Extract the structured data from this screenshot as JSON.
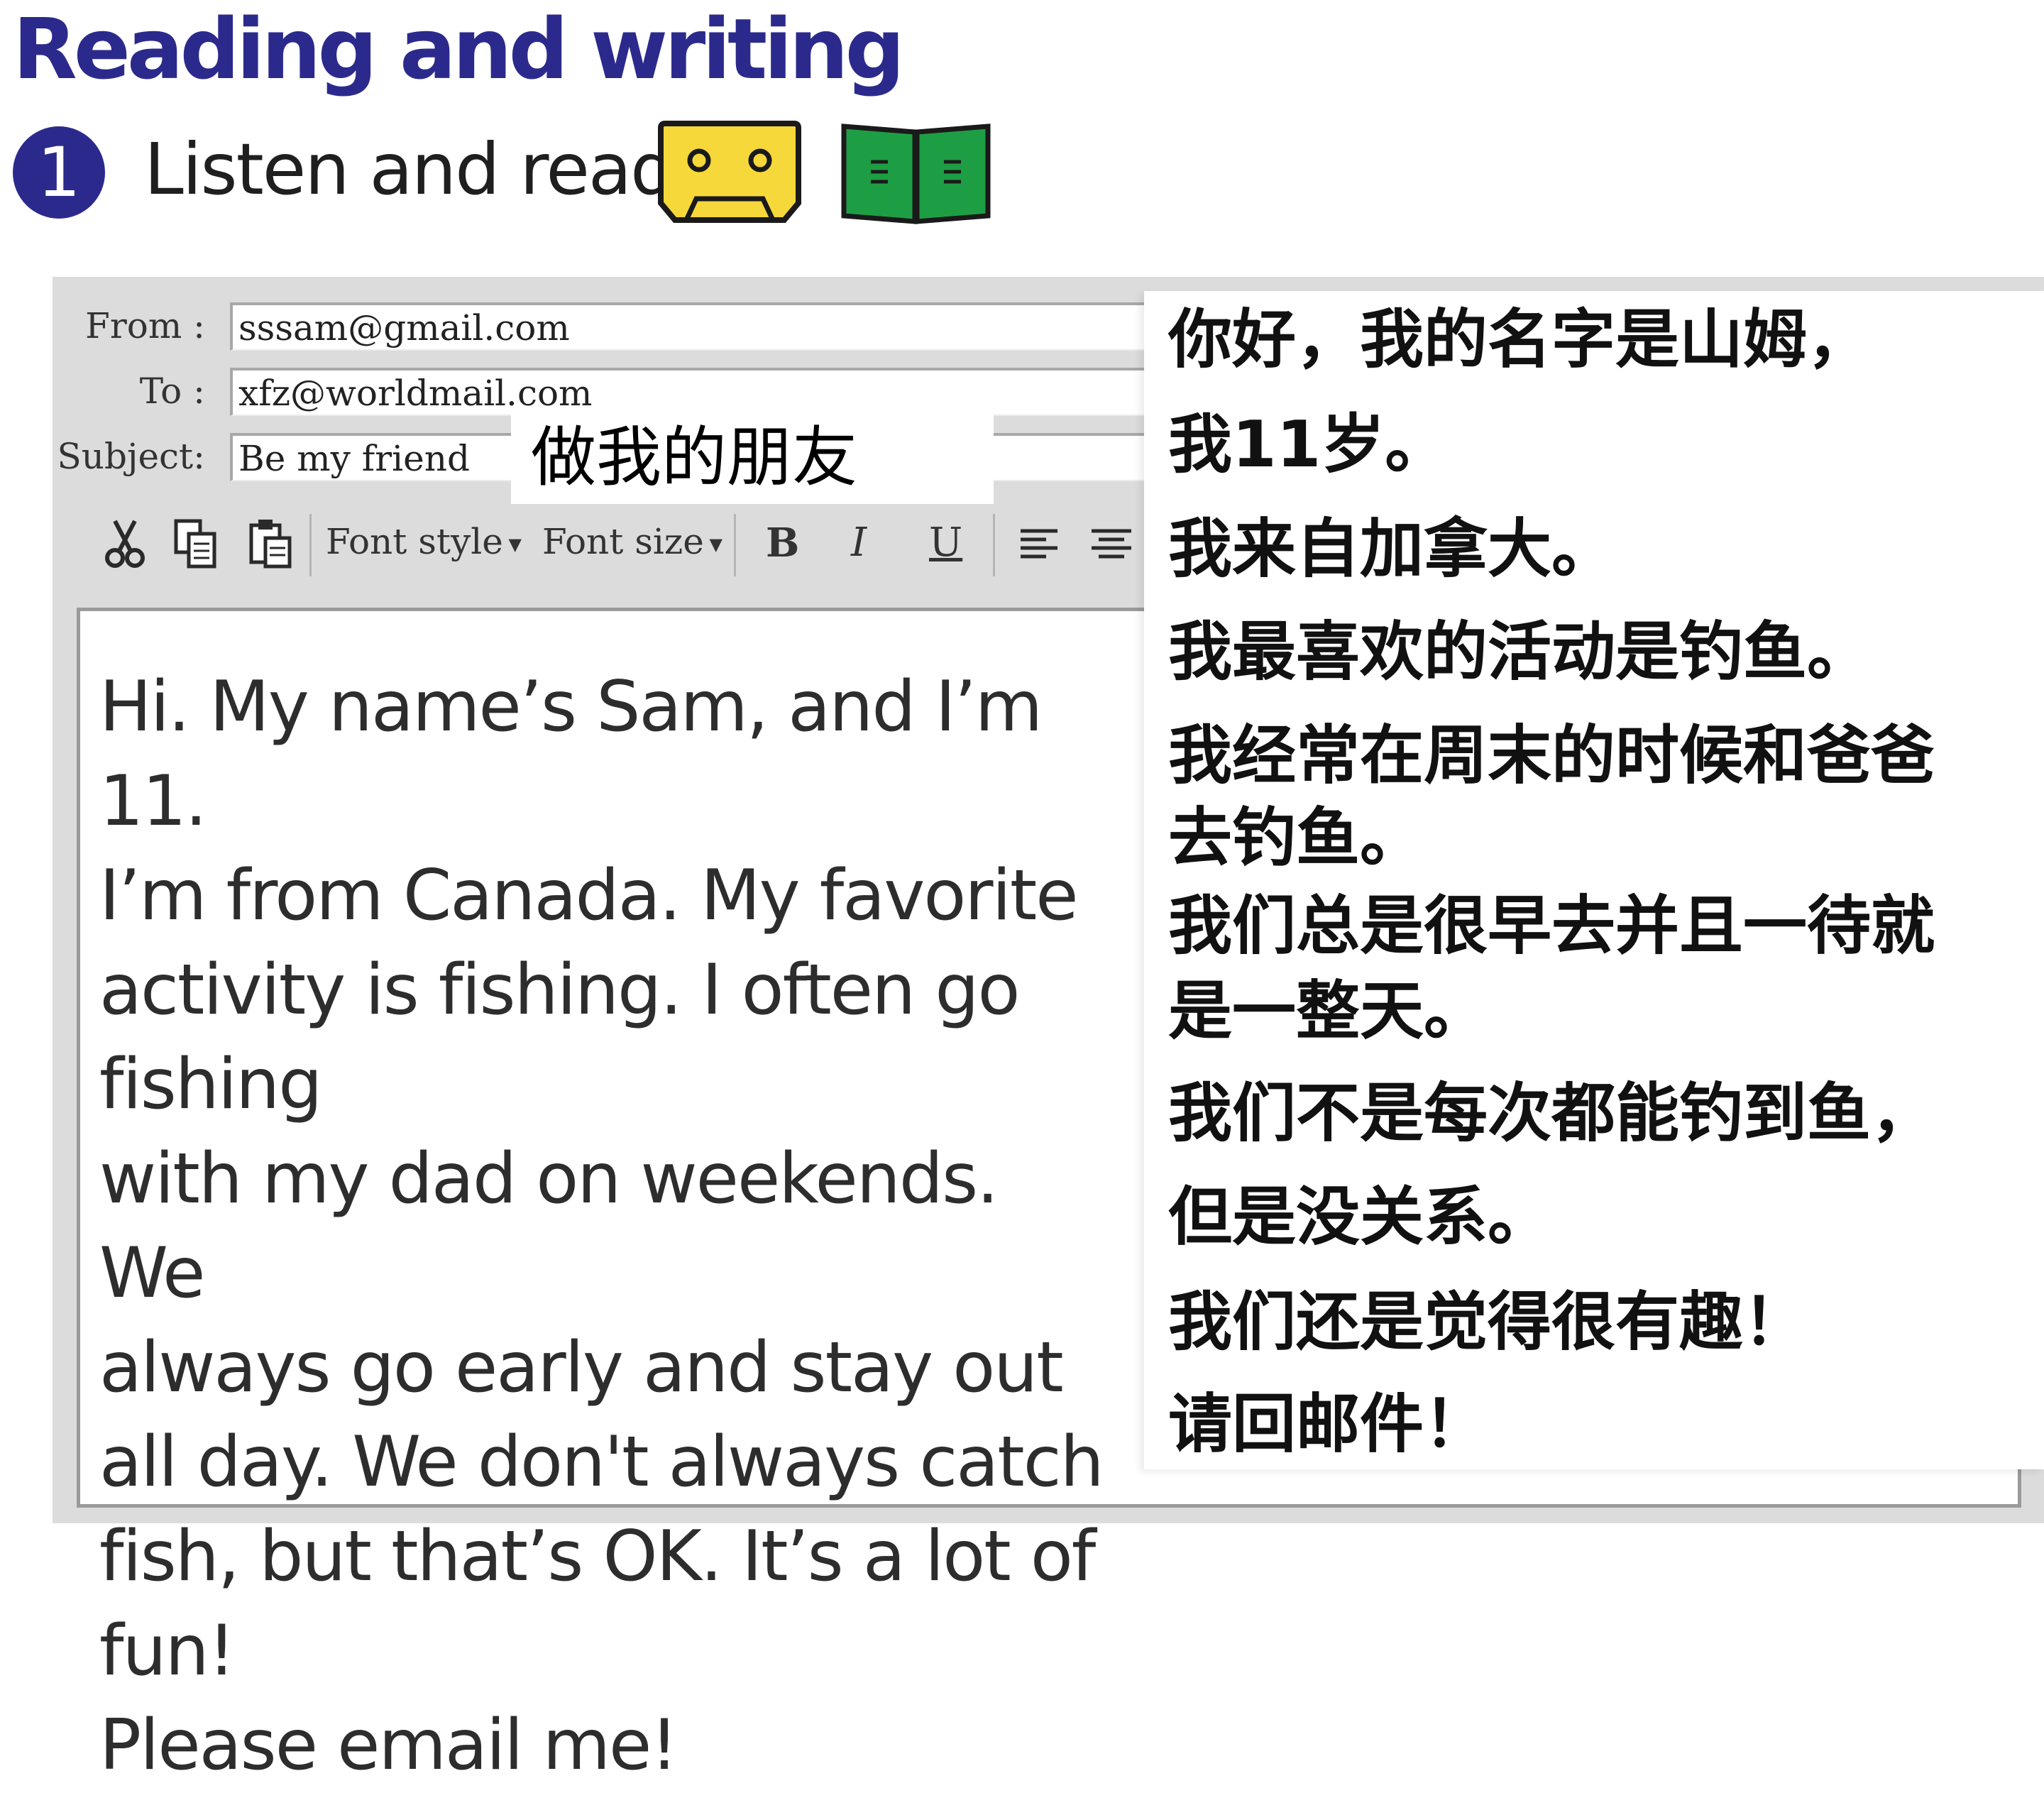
{
  "heading": "Reading and writing",
  "exercise": {
    "number": "1",
    "instruction": "Listen and read."
  },
  "icons": {
    "cassette": "cassette-icon",
    "book": "open-book-icon",
    "cut": "scissors-icon",
    "copy": "copy-icon",
    "paste": "paste-icon",
    "align_left": "align-left-icon",
    "align_center": "align-center-icon"
  },
  "colors": {
    "heading": "#2b2a8c",
    "cassette": "#f7d83a",
    "book": "#1e9e44"
  },
  "email": {
    "from_label": "From :",
    "from_value": "sssam@gmail.com",
    "to_label": "To :",
    "to_value": "xfz@worldmail.com",
    "subject_label": "Subject:",
    "subject_value": "Be my friend",
    "toolbar": {
      "font_style": "Font style",
      "font_size": "Font size",
      "bold": "B",
      "italic": "I",
      "underline": "U"
    },
    "body": "Hi. My name’s Sam, and I’m 11.\nI’m from Canada. My favorite\nactivity is fishing. I often go fishing\nwith my dad on weekends. We\nalways go early and stay out\nall day. We don't always catch\nfish, but that’s OK. It’s a lot of fun!\nPlease email me!"
  },
  "translation": {
    "subject": "做我的朋友",
    "lines": [
      "你好，我的名字是山姆，",
      "我11岁。",
      "我来自加拿大。",
      "我最喜欢的活动是钓鱼。",
      "我经常在周末的时候和爸爸",
      "去钓鱼。",
      "我们总是很早去并且一待就",
      "是一整天。",
      "我们不是每次都能钓到鱼，",
      "但是没关系。",
      "我们还是觉得很有趣！",
      "请回邮件！"
    ]
  }
}
